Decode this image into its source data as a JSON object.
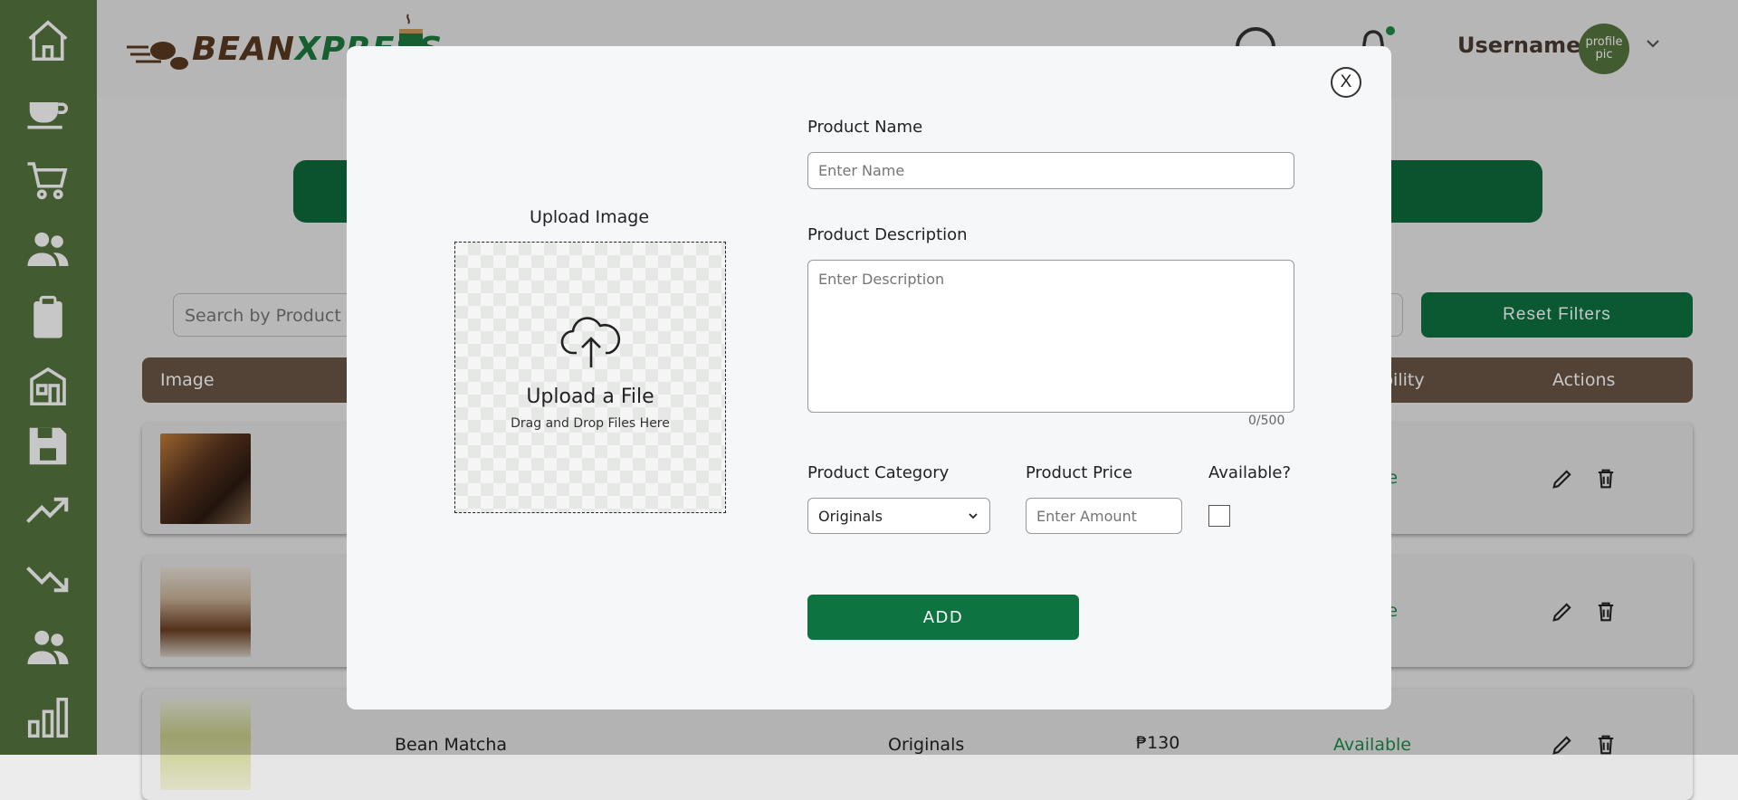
{
  "brand": {
    "logo_word_1": "BEAN",
    "logo_word_2": "XPRESS"
  },
  "sidebar": {
    "items": [
      {
        "icon": "home-icon"
      },
      {
        "icon": "coffee-cup-icon"
      },
      {
        "icon": "cart-icon"
      },
      {
        "icon": "users-icon"
      },
      {
        "icon": "clipboard-icon"
      },
      {
        "icon": "store-icon"
      },
      {
        "icon": "save-icon"
      },
      {
        "icon": "trending-up-icon"
      },
      {
        "icon": "trending-down-icon"
      },
      {
        "icon": "people-icon"
      },
      {
        "icon": "bar-chart-icon"
      }
    ]
  },
  "header": {
    "username": "Username",
    "avatar_text": "profile pic",
    "icons": [
      "search-icon",
      "bell-icon",
      "chevron-down-icon"
    ]
  },
  "filters": {
    "search_placeholder": "Search by Product",
    "reset_label": "Reset Filters"
  },
  "table": {
    "columns": [
      "Image",
      "Availability",
      "Actions"
    ],
    "visible_column_parts": {
      "availability": "bility"
    },
    "rows": [
      {
        "availability": "Available",
        "availability_visible": "ble"
      },
      {
        "availability": "Available",
        "availability_visible": "ble"
      },
      {
        "name": "Bean Matcha",
        "category": "Originals",
        "price": "₱130",
        "availability": "Available"
      }
    ]
  },
  "modal": {
    "close_label": "X",
    "upload": {
      "label": "Upload Image",
      "title": "Upload a File",
      "subtitle": "Drag and Drop Files Here"
    },
    "product_name": {
      "label": "Product Name",
      "placeholder": "Enter Name"
    },
    "product_description": {
      "label": "Product Description",
      "placeholder": "Enter Description",
      "counter": "0/500"
    },
    "product_category": {
      "label": "Product Category",
      "selected": "Originals"
    },
    "product_price": {
      "label": "Product Price",
      "placeholder": "Enter Amount"
    },
    "available": {
      "label": "Available?",
      "checked": false
    },
    "add_label": "ADD"
  },
  "colors": {
    "sidebar": "#56753f",
    "primary_green": "#0d7341",
    "table_header": "#6b5747",
    "available_text": "#1d8a4a"
  }
}
